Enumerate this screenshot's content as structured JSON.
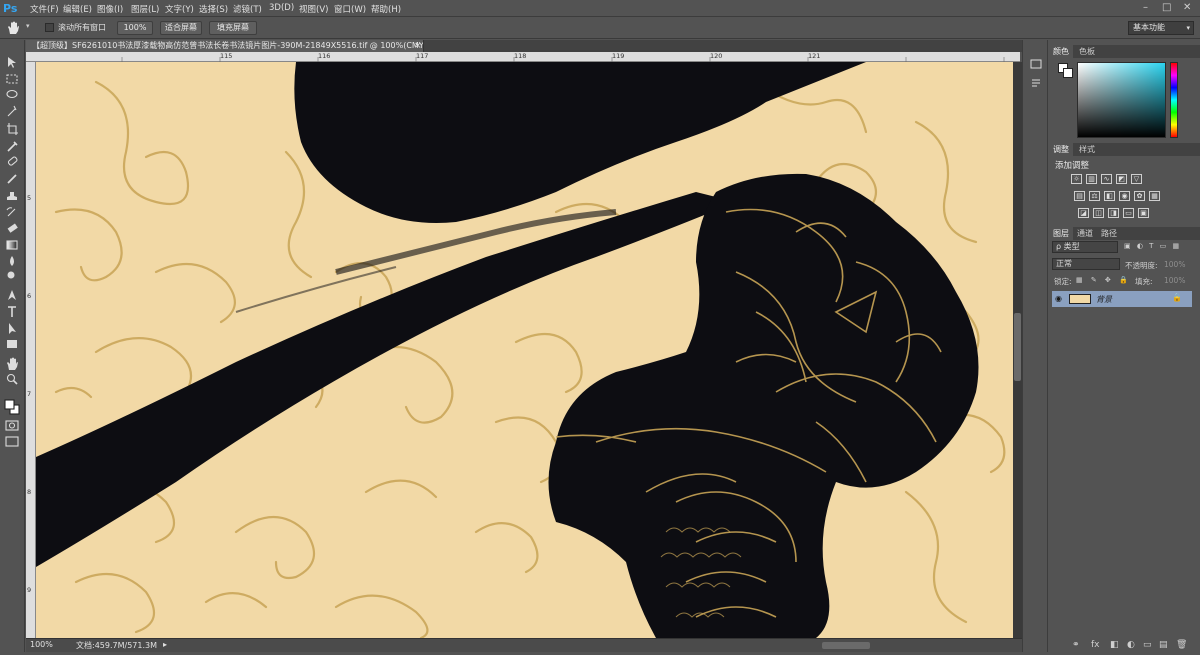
{
  "app": {
    "logo": "Ps"
  },
  "menu": [
    "文件(F)",
    "编辑(E)",
    "图像(I)",
    "图层(L)",
    "文字(Y)",
    "选择(S)",
    "滤镜(T)",
    "3D(D)",
    "视图(V)",
    "窗口(W)",
    "帮助(H)"
  ],
  "window_controls": {
    "minimize": "–",
    "restore": "□",
    "close": "✕"
  },
  "options": {
    "scroll_all_label": "滚动所有窗口",
    "zoom_100": "100%",
    "fit_screen": "适合屏幕",
    "fill_screen": "填充屏幕",
    "workspace": "基本功能"
  },
  "document": {
    "tab_title": "【超顶级】SF6261010书法厚漆载物高仿范曾书法长卷书法镜片图片-390M-21849X5516.tif @ 100%(CMYK/8*)",
    "close_glyph": "×"
  },
  "ruler_top": [
    "115",
    "116",
    "117",
    "118",
    "119",
    "120",
    "121"
  ],
  "ruler_left": [
    "5",
    "6",
    "7",
    "8",
    "9"
  ],
  "status": {
    "zoom": "100%",
    "doc": "文档:459.7M/571.3M"
  },
  "panels": {
    "color_tabs": [
      "颜色",
      "色板"
    ],
    "adjust_tabs": [
      "调整",
      "样式"
    ],
    "adjust_title": "添加调整",
    "layers_tabs": [
      "图层",
      "通道",
      "路径"
    ],
    "layer_filter": "类型",
    "blend_mode": "正常",
    "opacity_label": "不透明度:",
    "opacity_value": "100%",
    "lock_label": "锁定:",
    "fill_label": "填充:",
    "fill_value": "100%",
    "layer_name": "背景",
    "bottom_icons": [
      "⚭",
      "fx",
      "◧",
      "◐",
      "▭",
      "▤",
      "🗑"
    ]
  },
  "colors": {
    "paper": "#f2d9a6",
    "ink": "#0d0d12",
    "gold": "#c8a456",
    "layer_highlight": "#8aa0c0"
  },
  "tools": [
    "move-icon",
    "marquee-icon",
    "lasso-icon",
    "quick-select-icon",
    "crop-icon",
    "eyedropper-icon",
    "healing-icon",
    "brush-icon",
    "stamp-icon",
    "history-brush-icon",
    "eraser-icon",
    "gradient-icon",
    "blur-icon",
    "dodge-icon",
    "pen-icon",
    "type-icon",
    "path-select-icon",
    "shape-icon",
    "hand-icon",
    "zoom-icon"
  ]
}
